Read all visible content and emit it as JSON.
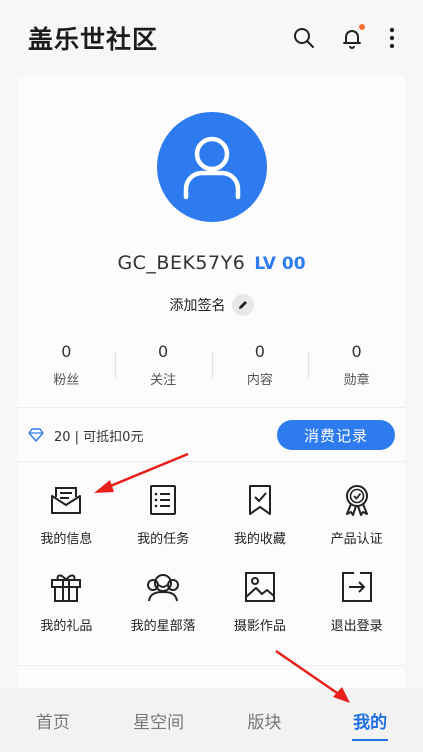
{
  "header": {
    "title": "盖乐世社区",
    "icons": [
      "search-icon",
      "bell-icon",
      "more-vertical-icon"
    ],
    "notification_dot_color": "#ff6d2e"
  },
  "profile": {
    "username": "GC_BEK57Y6",
    "level": "LV 00",
    "signature_prompt": "添加签名",
    "avatar_color": "#2e7bf0"
  },
  "stats": [
    {
      "value": "0",
      "label": "粉丝"
    },
    {
      "value": "0",
      "label": "关注"
    },
    {
      "value": "0",
      "label": "内容"
    },
    {
      "value": "0",
      "label": "勋章"
    }
  ],
  "points": {
    "text": "20 | 可抵扣0元",
    "icon": "diamond-icon",
    "button": "消费记录"
  },
  "menu": [
    {
      "label": "我的信息",
      "icon": "message-icon"
    },
    {
      "label": "我的任务",
      "icon": "task-list-icon"
    },
    {
      "label": "我的收藏",
      "icon": "bookmark-icon"
    },
    {
      "label": "产品认证",
      "icon": "certificate-icon"
    },
    {
      "label": "我的礼品",
      "icon": "gift-icon"
    },
    {
      "label": "我的星部落",
      "icon": "community-icon"
    },
    {
      "label": "摄影作品",
      "icon": "photo-icon"
    },
    {
      "label": "退出登录",
      "icon": "logout-icon"
    }
  ],
  "bottom_nav": [
    {
      "label": "首页",
      "active": false
    },
    {
      "label": "星空间",
      "active": false
    },
    {
      "label": "版块",
      "active": false
    },
    {
      "label": "我的",
      "active": true
    }
  ],
  "colors": {
    "accent": "#2e7bf0",
    "annotation": "#e8201c"
  }
}
